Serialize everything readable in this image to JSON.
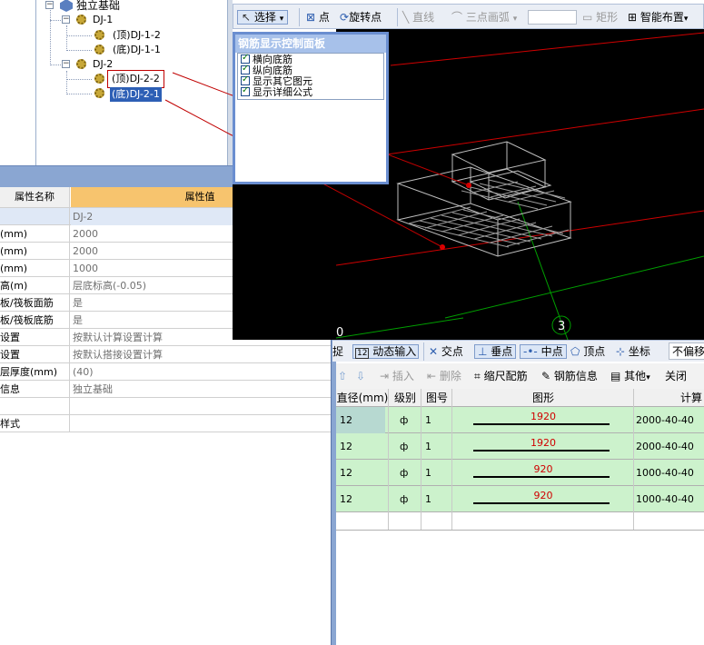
{
  "tree": {
    "root_label": "独立基础",
    "nodes": [
      {
        "label": "DJ-1"
      },
      {
        "label": "(顶)DJ-1-2"
      },
      {
        "label": "(底)DJ-1-1"
      },
      {
        "label": "DJ-2"
      },
      {
        "label": "(顶)DJ-2-2"
      },
      {
        "label": "(底)DJ-2-1"
      }
    ]
  },
  "properties": {
    "header_name": "属性名称",
    "header_value": "属性值",
    "rows": [
      {
        "name": "",
        "value": "DJ-2"
      },
      {
        "name": "(mm)",
        "value": "2000"
      },
      {
        "name": "(mm)",
        "value": "2000"
      },
      {
        "name": "(mm)",
        "value": "1000"
      },
      {
        "name": "高(m)",
        "value": "层底标高(-0.05)"
      },
      {
        "name": "板/筏板面筋",
        "value": "是"
      },
      {
        "name": "板/筏板底筋",
        "value": "是"
      },
      {
        "name": "设置",
        "value": "按默认计算设置计算"
      },
      {
        "name": "设置",
        "value": "按默认搭接设置计算"
      },
      {
        "name": "层厚度(mm)",
        "value": "(40)"
      },
      {
        "name": "信息",
        "value": "独立基础"
      },
      {
        "name": "",
        "value": ""
      },
      {
        "name": "样式",
        "value": ""
      }
    ]
  },
  "top_toolbar": {
    "select": "选择",
    "point": "点",
    "rotate_point": "旋转点",
    "line": "直线",
    "arc3": "三点画弧",
    "rect": "矩形",
    "smart_layout": "智能布置"
  },
  "control_panel": {
    "title": "钢筋显示控制面板",
    "items": [
      "横向底筋",
      "纵向底筋",
      "显示其它图元",
      "显示详细公式"
    ]
  },
  "viewport": {
    "axis_label_3": "3",
    "axis_label_0": "0"
  },
  "snap_bar": {
    "capture_tail": "捉",
    "dynamic_input": "动态输入",
    "intersection": "交点",
    "perpendicular": "垂点",
    "midpoint": "中点",
    "vertex": "顶点",
    "coordinate": "坐标",
    "no_offset": "不偏移"
  },
  "rebar_toolbar": {
    "insert": "插入",
    "delete": "删除",
    "scale_rebar": "缩尺配筋",
    "rebar_info": "钢筋信息",
    "other": "其他",
    "close": "关闭"
  },
  "rebar_grid": {
    "headers": {
      "diameter": "直径(mm)",
      "grade": "级别",
      "figure_no": "图号",
      "shape": "图形",
      "calc": "计算"
    },
    "rows": [
      {
        "diameter": "12",
        "grade": "ф",
        "figure_no": "1",
        "shape_len": "1920",
        "calc": "2000-40-40"
      },
      {
        "diameter": "12",
        "grade": "ф",
        "figure_no": "1",
        "shape_len": "1920",
        "calc": "2000-40-40"
      },
      {
        "diameter": "12",
        "grade": "ф",
        "figure_no": "1",
        "shape_len": "920",
        "calc": "1000-40-40"
      },
      {
        "diameter": "12",
        "grade": "ф",
        "figure_no": "1",
        "shape_len": "920",
        "calc": "1000-40-40"
      }
    ]
  },
  "colors": {
    "panel_blue": "#8aa6d2",
    "header_orange": "#f7c46e",
    "row_green": "#ccf2cc",
    "selection": "#2d5fb5",
    "annotation_red": "#c00000"
  }
}
